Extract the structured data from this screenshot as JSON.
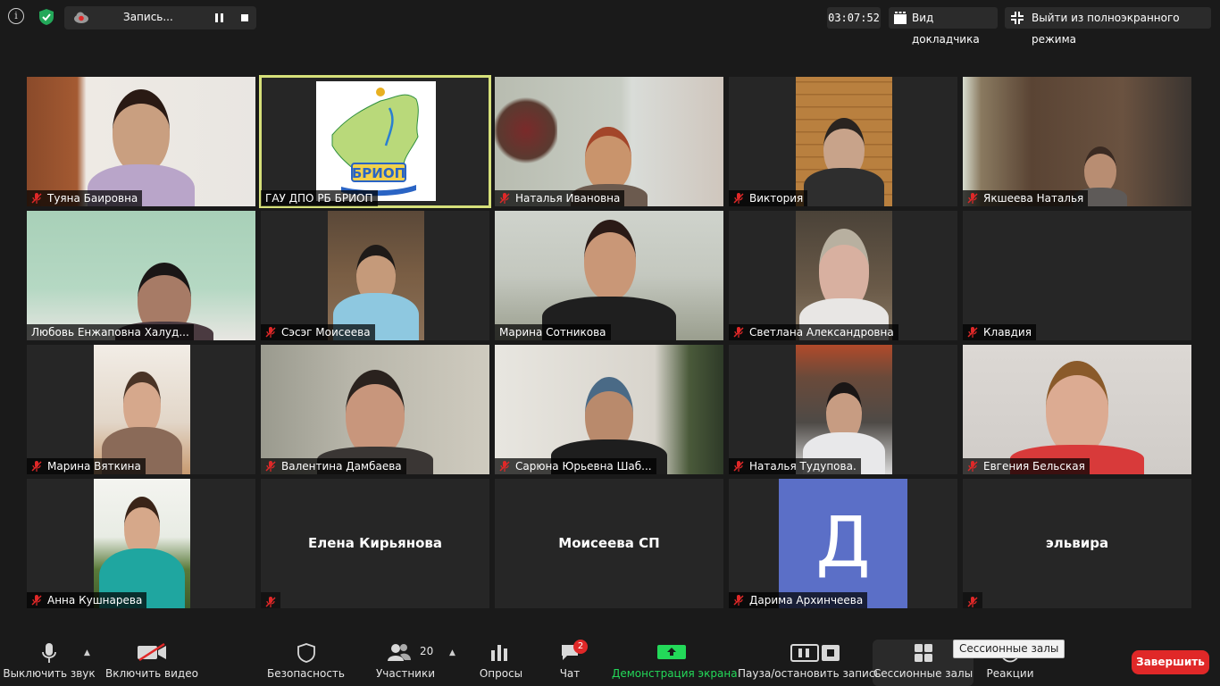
{
  "topbar": {
    "recording_label": "Запись...",
    "timer": "03:07:52",
    "view_label": "Вид докладчика",
    "exit_fullscreen_label": "Выйти из полноэкранного режима"
  },
  "participants": [
    {
      "name": "Туяна Баировна",
      "muted": true
    },
    {
      "name": "ГАУ ДПО РБ БРИОП",
      "muted": false,
      "active_speaker": true,
      "logo_text": "БРИОП"
    },
    {
      "name": "Наталья Ивановна",
      "muted": true
    },
    {
      "name": "Виктория",
      "muted": true
    },
    {
      "name": "Якшеева Наталья",
      "muted": true
    },
    {
      "name": "Любовь Енжаповна Халуд...",
      "muted": false
    },
    {
      "name": "Сэсэг Моисеева",
      "muted": true
    },
    {
      "name": "Марина Сотникова",
      "muted": false
    },
    {
      "name": "Светлана Александровна",
      "muted": true
    },
    {
      "name": "Клавдия",
      "muted": true
    },
    {
      "name": "Марина Вяткина",
      "muted": true
    },
    {
      "name": "Валентина Дамбаева",
      "muted": true
    },
    {
      "name": "Сарюна Юрьевна Шаб...",
      "muted": true
    },
    {
      "name": "Наталья Тудупова.",
      "muted": true
    },
    {
      "name": "Евгения Бельская",
      "muted": true
    },
    {
      "name": "Анна Кушнарева",
      "muted": true
    },
    {
      "name": "Елена Кирьянова",
      "muted": true,
      "video_off": true
    },
    {
      "name": "Моисеева СП",
      "muted": false,
      "video_off": true
    },
    {
      "name": "Дарима Архинчеева",
      "muted": true,
      "avatar_letter": "Д",
      "avatar_color": "#5b6fc7"
    },
    {
      "name": "эльвира",
      "muted": true,
      "video_off": true
    }
  ],
  "toolbar": {
    "mute_label": "Выключить звук",
    "video_label": "Включить видео",
    "security_label": "Безопасность",
    "participants_label": "Участники",
    "participants_count": "20",
    "polls_label": "Опросы",
    "chat_label": "Чат",
    "chat_badge": "2",
    "share_label": "Демонстрация экрана",
    "record_label": "Пауза/остановить запись",
    "breakout_label": "Сессионные залы",
    "reactions_label": "Реакции",
    "end_label": "Завершить",
    "tooltip": "Сессионные залы"
  },
  "colors": {
    "accent_green": "#23d959",
    "active_border": "#d6e07a",
    "end_red": "#e02828",
    "mute_red": "#e02828"
  }
}
